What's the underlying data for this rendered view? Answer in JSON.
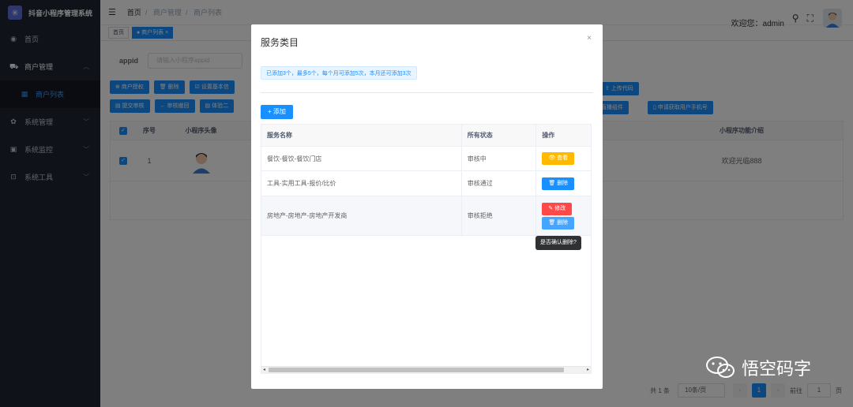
{
  "app": {
    "title": "抖音小程序管理系统",
    "logo_glyph": "✳"
  },
  "sidebar": {
    "items": [
      {
        "label": "首页",
        "icon": "dashboard-icon",
        "glyph": "◉"
      },
      {
        "label": "商户管理",
        "icon": "merchant-icon",
        "glyph": "⛟"
      },
      {
        "label": "商户列表",
        "icon": "list-icon",
        "glyph": "▦"
      },
      {
        "label": "系统管理",
        "icon": "gear-icon",
        "glyph": "✿"
      },
      {
        "label": "系统监控",
        "icon": "monitor-icon",
        "glyph": "▣"
      },
      {
        "label": "系统工具",
        "icon": "toolbox-icon",
        "glyph": "⊡"
      }
    ]
  },
  "header": {
    "breadcrumb": [
      "首页",
      "商户管理",
      "商户列表"
    ],
    "welcome": "欢迎您：admin",
    "search_icon": "⚲",
    "fullscreen_icon": "⛶"
  },
  "tags": [
    {
      "label": "首页"
    },
    {
      "label": "● 商户列表 ×"
    }
  ],
  "filter": {
    "label": "appid",
    "placeholder": "请输入小程序appid"
  },
  "toolbar_row1": [
    "⊕ 商户授权",
    "🗑 删除",
    "☑ 设置基本信",
    "⇪ 上传代码"
  ],
  "toolbar_row2": [
    "▤ 提交审核",
    "← 审核撤回",
    "▤ 体验二",
    "音直播组件",
    "▯ 申请获取用户手机号"
  ],
  "table": {
    "headers": {
      "no": "序号",
      "avatar": "小程序头像",
      "intro": "小程序功能介绍"
    },
    "row": {
      "no": "1",
      "intro": "欢迎光临888"
    }
  },
  "pagination": {
    "total": "共 1 条",
    "size": "10条/页",
    "current": "1",
    "goto_label": "前往",
    "goto_value": "1",
    "page_suffix": "页"
  },
  "dialog": {
    "title": "服务类目",
    "close": "×",
    "notice": "已添加3个，最多5个，每个月可添加5次，本月还可添加3次",
    "add_label": "+ 添加",
    "columns": [
      "服务名称",
      "所有状态",
      "操作"
    ],
    "rows": [
      {
        "name": "餐饮-餐饮-餐饮门店",
        "status": "审核中",
        "actions": [
          {
            "label": "👁 查看",
            "color": "#ffba00"
          }
        ]
      },
      {
        "name": "工具-实用工具-报价/比价",
        "status": "审核通过",
        "actions": [
          {
            "label": "🗑 删除",
            "color": "#1890ff"
          }
        ]
      },
      {
        "name": "房地产-房地产-房地产开发商",
        "status": "审核拒绝",
        "actions": [
          {
            "label": "✎ 修改",
            "color": "#ff4949"
          },
          {
            "label": "🗑 删除",
            "color": "#46a6ff"
          }
        ]
      }
    ],
    "tooltip": "是否确认删除?"
  },
  "watermark": "悟空码字"
}
